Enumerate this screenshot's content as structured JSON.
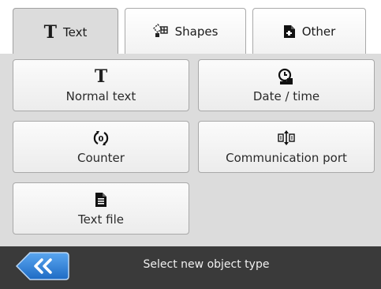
{
  "tabs": [
    {
      "label": "Text",
      "icon": "text-icon",
      "active": true
    },
    {
      "label": "Shapes",
      "icon": "shapes-icon",
      "active": false
    },
    {
      "label": "Other",
      "icon": "document-icon",
      "active": false
    }
  ],
  "objects": [
    {
      "label": "Normal text",
      "icon": "text-icon"
    },
    {
      "label": "Date / time",
      "icon": "clock-icon"
    },
    {
      "label": "Counter",
      "icon": "counter-icon"
    },
    {
      "label": "Communication port",
      "icon": "communication-port-icon"
    },
    {
      "label": "Text file",
      "icon": "text-file-icon"
    }
  ],
  "footer": {
    "back_icon": "double-chevron-left-icon",
    "status": "Select new object type"
  },
  "colors": {
    "panel": "#dcdcdc",
    "footer": "#3a3a3a",
    "back_button": "#2f7fd8"
  }
}
